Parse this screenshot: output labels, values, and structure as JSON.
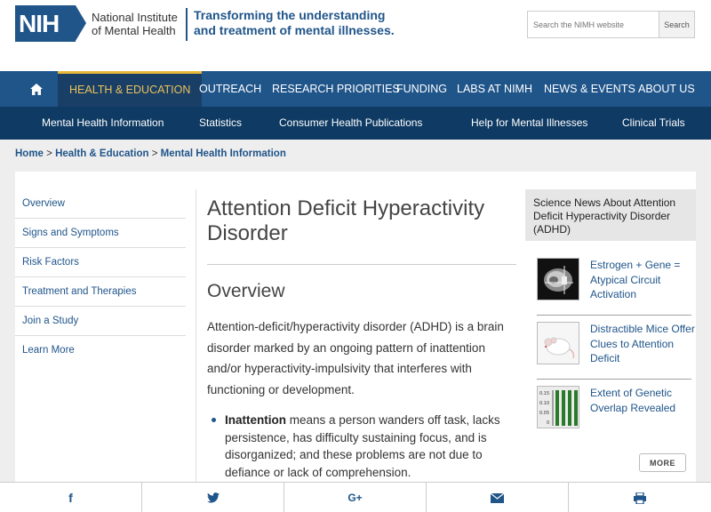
{
  "header": {
    "logo_abbr": "NIH",
    "logo_line1": "National Institute",
    "logo_line2": "of Mental Health",
    "tagline_line1": "Transforming the understanding",
    "tagline_line2": "and treatment of mental illnesses.",
    "search_placeholder": "Search the NIMH website",
    "search_button": "Search"
  },
  "nav": {
    "home_icon": "home-icon",
    "items": [
      "HEALTH & EDUCATION",
      "OUTREACH",
      "RESEARCH PRIORITIES",
      "FUNDING",
      "LABS AT NIMH",
      "NEWS & EVENTS",
      "ABOUT US"
    ],
    "active_color": "#e7b83a"
  },
  "subnav": {
    "items": [
      "Mental Health Information",
      "Statistics",
      "Consumer Health Publications",
      "Help for Mental Illnesses",
      "Clinical Trials"
    ]
  },
  "breadcrumb": {
    "items": [
      "Home",
      "Health & Education",
      "Mental Health Information"
    ],
    "separator": ">"
  },
  "sidebar": {
    "items": [
      "Overview",
      "Signs and Symptoms",
      "Risk Factors",
      "Treatment and Therapies",
      "Join a Study",
      "Learn More"
    ]
  },
  "main": {
    "title": "Attention Deficit Hyperactivity Disorder",
    "section_heading": "Overview",
    "intro": "Attention-deficit/hyperactivity disorder (ADHD) is a brain disorder marked by an ongoing pattern of inattention and/or hyperactivity-impulsivity that interferes with functioning or development.",
    "bullet1_term": "Inattention",
    "bullet1_text": " means a person wanders off task, lacks persistence, has difficulty sustaining focus, and is disorganized; and these problems are not due to defiance or lack of comprehension."
  },
  "news": {
    "heading": "Science News About Attention Deficit Hyperactivity Disorder (ADHD)",
    "items": [
      {
        "title": "Estrogen + Gene = Atypical Circuit Activation",
        "thumb": "brain-scan-thumbnail"
      },
      {
        "title": "Distractible Mice Offer Clues to Attention Deficit",
        "thumb": "mouse-thumbnail"
      },
      {
        "title": "Extent of Genetic Overlap Revealed",
        "thumb": "bar-chart-thumbnail"
      }
    ],
    "chart_ticks": [
      "0.15",
      "0.10",
      "0.05",
      "0"
    ],
    "more_button": "MORE"
  },
  "share": {
    "icons": [
      "facebook-icon",
      "twitter-icon",
      "google-plus-icon",
      "email-icon",
      "print-icon"
    ],
    "glyphs": [
      "f",
      "",
      "G+",
      "",
      ""
    ]
  },
  "colors": {
    "brand_blue": "#20558a",
    "dark_blue": "#0e3a63",
    "accent_gold": "#e7b83a"
  }
}
